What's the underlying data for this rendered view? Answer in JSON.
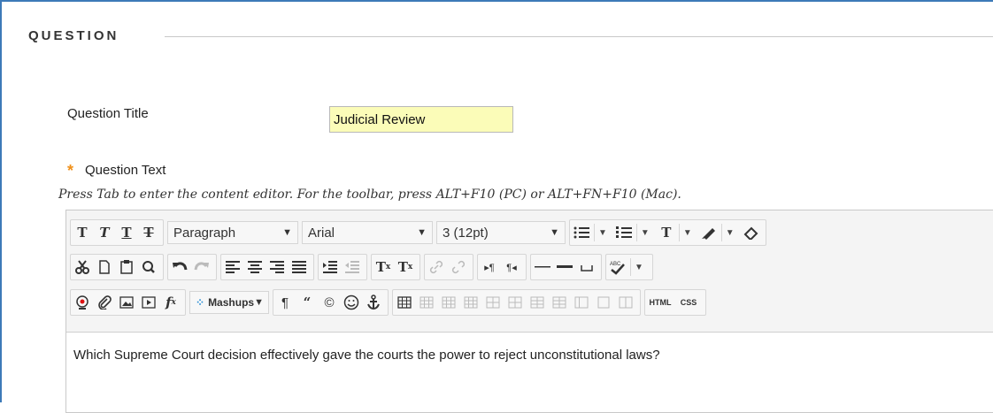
{
  "section": {
    "heading": "QUESTION"
  },
  "question_title": {
    "label": "Question Title",
    "value": "Judicial Review"
  },
  "question_text": {
    "required_marker": "*",
    "label": "Question Text",
    "hint": "Press Tab to enter the content editor. For the toolbar, press ALT+F10 (PC) or ALT+FN+F10 (Mac)."
  },
  "toolbar": {
    "row1": {
      "format_buttons": [
        "T",
        "T",
        "T",
        "T"
      ],
      "paragraph_value": "Paragraph",
      "font_value": "Arial",
      "size_value": "3 (12pt)",
      "text_color_glyph": "T"
    },
    "row2": {
      "superscript_glyph": "T",
      "subscript_glyph": "T"
    },
    "row3": {
      "mashups_label": "Mashups",
      "html_label": "HTML",
      "css_label": "CSS"
    }
  },
  "editor_content": "Which Supreme Court decision effectively gave the courts the power to reject unconstitutional laws?",
  "colors": {
    "frame_border": "#3d7ab8",
    "required": "#f0901a",
    "title_input_bg": "#fbfcb8"
  }
}
